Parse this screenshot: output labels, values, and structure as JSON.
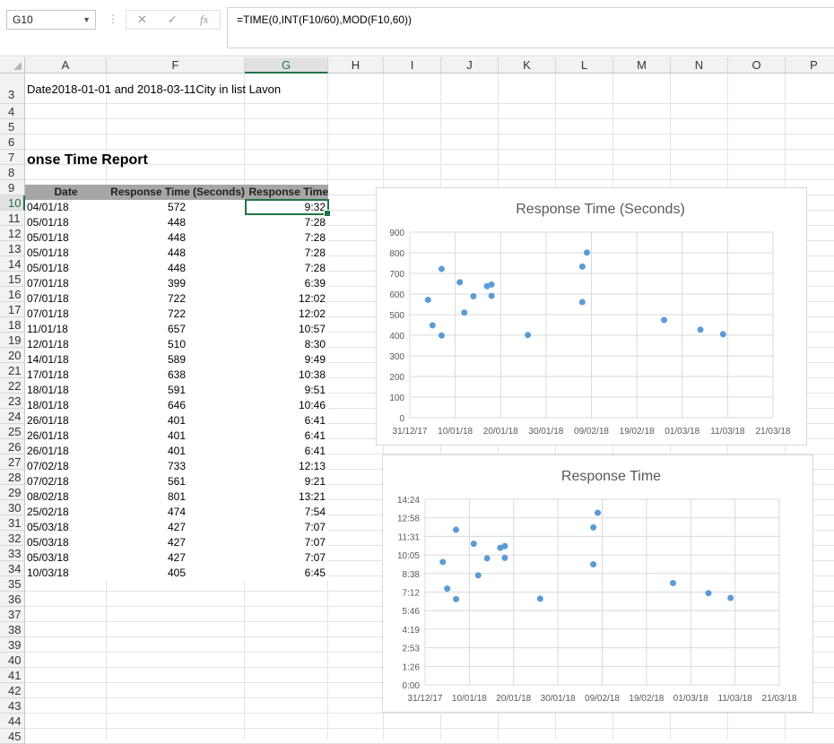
{
  "formula_bar": {
    "name_box": "G10",
    "formula": "=TIME(0,INT(F10/60),MOD(F10,60))",
    "cancel_icon": "close-icon",
    "enter_icon": "check-icon",
    "fx_label": "fx"
  },
  "columns": [
    "A",
    "F",
    "G",
    "H",
    "I",
    "J",
    "K",
    "L",
    "M",
    "N",
    "O",
    "P"
  ],
  "row_numbers": [
    "3",
    "4",
    "5",
    "6",
    "7",
    "8",
    "9",
    "10",
    "11",
    "12",
    "13",
    "14",
    "15",
    "16",
    "17",
    "18",
    "19",
    "20",
    "21",
    "22",
    "23",
    "24",
    "25",
    "26",
    "27",
    "28",
    "29",
    "30",
    "31",
    "32",
    "33",
    "34",
    "35",
    "36",
    "37",
    "38",
    "39",
    "40",
    "41",
    "42",
    "43",
    "44",
    "45"
  ],
  "filter_text": "Date2018-01-01 and 2018-03-11City in list Lavon",
  "report_title": "onse Time Report",
  "table": {
    "headers": [
      "Date",
      "Response Time (Seconds)",
      "Response Time"
    ],
    "rows": [
      [
        "04/01/18",
        "572",
        "9:32"
      ],
      [
        "05/01/18",
        "448",
        "7:28"
      ],
      [
        "05/01/18",
        "448",
        "7:28"
      ],
      [
        "05/01/18",
        "448",
        "7:28"
      ],
      [
        "05/01/18",
        "448",
        "7:28"
      ],
      [
        "07/01/18",
        "399",
        "6:39"
      ],
      [
        "07/01/18",
        "722",
        "12:02"
      ],
      [
        "07/01/18",
        "722",
        "12:02"
      ],
      [
        "11/01/18",
        "657",
        "10:57"
      ],
      [
        "12/01/18",
        "510",
        "8:30"
      ],
      [
        "14/01/18",
        "589",
        "9:49"
      ],
      [
        "17/01/18",
        "638",
        "10:38"
      ],
      [
        "18/01/18",
        "591",
        "9:51"
      ],
      [
        "18/01/18",
        "646",
        "10:46"
      ],
      [
        "26/01/18",
        "401",
        "6:41"
      ],
      [
        "26/01/18",
        "401",
        "6:41"
      ],
      [
        "26/01/18",
        "401",
        "6:41"
      ],
      [
        "07/02/18",
        "733",
        "12:13"
      ],
      [
        "07/02/18",
        "561",
        "9:21"
      ],
      [
        "08/02/18",
        "801",
        "13:21"
      ],
      [
        "25/02/18",
        "474",
        "7:54"
      ],
      [
        "05/03/18",
        "427",
        "7:07"
      ],
      [
        "05/03/18",
        "427",
        "7:07"
      ],
      [
        "05/03/18",
        "427",
        "7:07"
      ],
      [
        "10/03/18",
        "405",
        "6:45"
      ]
    ]
  },
  "colors": {
    "accent": "#217346",
    "marker": "#5b9bd5",
    "header_band": "#a6a6a6"
  },
  "chart_data": [
    {
      "type": "scatter",
      "title": "Response Time (Seconds)",
      "x_tick_labels": [
        "31/12/17",
        "10/01/18",
        "20/01/18",
        "30/01/18",
        "09/02/18",
        "19/02/18",
        "01/03/18",
        "11/03/18",
        "21/03/18"
      ],
      "y_tick_labels": [
        "0",
        "100",
        "200",
        "300",
        "400",
        "500",
        "600",
        "700",
        "800",
        "900"
      ],
      "xlim": [
        "2017-12-31",
        "2018-03-21"
      ],
      "ylim": [
        0,
        900
      ],
      "grid": true,
      "points": [
        {
          "x": "2018-01-04",
          "y": 572
        },
        {
          "x": "2018-01-05",
          "y": 448
        },
        {
          "x": "2018-01-07",
          "y": 399
        },
        {
          "x": "2018-01-07",
          "y": 722
        },
        {
          "x": "2018-01-11",
          "y": 657
        },
        {
          "x": "2018-01-12",
          "y": 510
        },
        {
          "x": "2018-01-14",
          "y": 589
        },
        {
          "x": "2018-01-17",
          "y": 638
        },
        {
          "x": "2018-01-18",
          "y": 591
        },
        {
          "x": "2018-01-18",
          "y": 646
        },
        {
          "x": "2018-01-26",
          "y": 401
        },
        {
          "x": "2018-02-07",
          "y": 733
        },
        {
          "x": "2018-02-07",
          "y": 561
        },
        {
          "x": "2018-02-08",
          "y": 801
        },
        {
          "x": "2018-02-25",
          "y": 474
        },
        {
          "x": "2018-03-05",
          "y": 427
        },
        {
          "x": "2018-03-10",
          "y": 405
        }
      ]
    },
    {
      "type": "scatter",
      "title": "Response Time",
      "x_tick_labels": [
        "31/12/17",
        "10/01/18",
        "20/01/18",
        "30/01/18",
        "09/02/18",
        "19/02/18",
        "01/03/18",
        "11/03/18",
        "21/03/18"
      ],
      "y_tick_labels": [
        "0:00",
        "1:26",
        "2:53",
        "4:19",
        "5:46",
        "7:12",
        "8:38",
        "10:05",
        "11:31",
        "12:58",
        "14:24"
      ],
      "xlim": [
        "2017-12-31",
        "2018-03-21"
      ],
      "ylim": [
        "0:00",
        "14:24"
      ],
      "grid": true,
      "points": [
        {
          "x": "2018-01-04",
          "y": "9:32"
        },
        {
          "x": "2018-01-05",
          "y": "7:28"
        },
        {
          "x": "2018-01-07",
          "y": "6:39"
        },
        {
          "x": "2018-01-07",
          "y": "12:02"
        },
        {
          "x": "2018-01-11",
          "y": "10:57"
        },
        {
          "x": "2018-01-12",
          "y": "8:30"
        },
        {
          "x": "2018-01-14",
          "y": "9:49"
        },
        {
          "x": "2018-01-17",
          "y": "10:38"
        },
        {
          "x": "2018-01-18",
          "y": "9:51"
        },
        {
          "x": "2018-01-18",
          "y": "10:46"
        },
        {
          "x": "2018-01-26",
          "y": "6:41"
        },
        {
          "x": "2018-02-07",
          "y": "12:13"
        },
        {
          "x": "2018-02-07",
          "y": "9:21"
        },
        {
          "x": "2018-02-08",
          "y": "13:21"
        },
        {
          "x": "2018-02-25",
          "y": "7:54"
        },
        {
          "x": "2018-03-05",
          "y": "7:07"
        },
        {
          "x": "2018-03-10",
          "y": "6:45"
        }
      ]
    }
  ]
}
